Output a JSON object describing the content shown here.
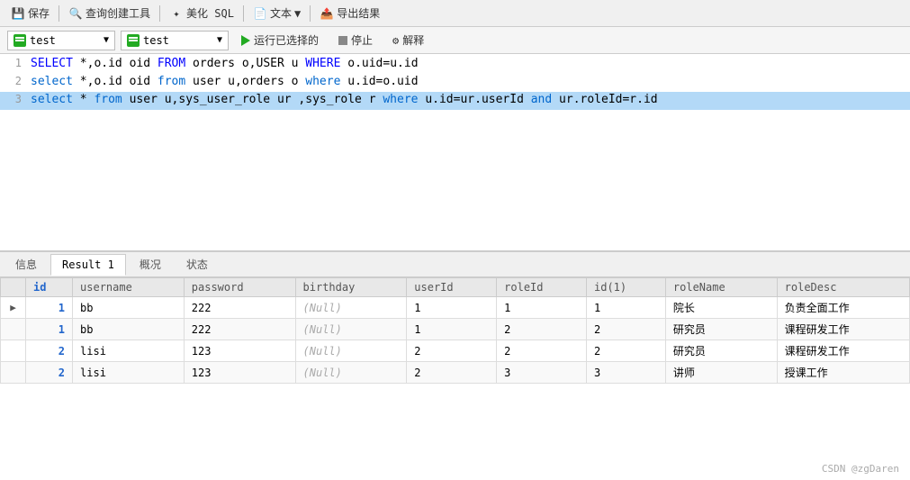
{
  "toolbar": {
    "save_label": "保存",
    "query_builder_label": "查询创建工具",
    "beautify_label": "美化 SQL",
    "text_label": "文本",
    "export_label": "导出结果"
  },
  "connection_bar": {
    "db1": "test",
    "db2": "test",
    "run_label": "运行已选择的",
    "stop_label": "停止",
    "explain_label": "解释"
  },
  "editor": {
    "lines": [
      {
        "number": "1",
        "highlighted": false,
        "raw": "SELECT *,o.id oid FROM orders o,USER u WHERE o.uid=u.id"
      },
      {
        "number": "2",
        "highlighted": false,
        "raw": "select *,o.id oid from user u,orders o where u.id=o.uid"
      },
      {
        "number": "3",
        "highlighted": true,
        "raw": "select * from user u,sys_user_role ur ,sys_role r where u.id=ur.userId and ur.roleId=r.id"
      }
    ]
  },
  "tabs": {
    "items": [
      "信息",
      "Result 1",
      "概况",
      "状态"
    ],
    "active": "Result 1"
  },
  "table": {
    "columns": [
      "id",
      "username",
      "password",
      "birthday",
      "userId",
      "roleId",
      "id(1)",
      "roleName",
      "roleDesc"
    ],
    "rows": [
      [
        "1",
        "bb",
        "222",
        "(Null)",
        "1",
        "1",
        "1",
        "院长",
        "负责全面工作"
      ],
      [
        "1",
        "bb",
        "222",
        "(Null)",
        "1",
        "2",
        "2",
        "研究员",
        "课程研发工作"
      ],
      [
        "2",
        "lisi",
        "123",
        "(Null)",
        "2",
        "2",
        "2",
        "研究员",
        "课程研发工作"
      ],
      [
        "2",
        "lisi",
        "123",
        "(Null)",
        "2",
        "3",
        "3",
        "讲师",
        "授课工作"
      ]
    ]
  },
  "watermark": "CSDN @zgDaren"
}
